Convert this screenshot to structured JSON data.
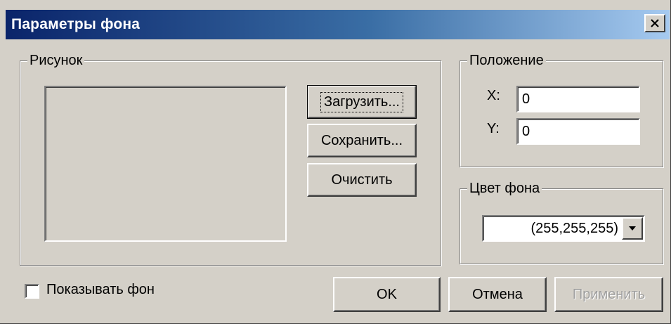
{
  "window": {
    "title": "Параметры фона",
    "close_icon": "close-icon"
  },
  "picture_group": {
    "label": "Рисунок",
    "load_button": "Загрузить...",
    "save_button": "Сохранить...",
    "clear_button": "Очистить"
  },
  "position_group": {
    "label": "Положение",
    "x_label": "X:",
    "x_value": "0",
    "y_label": "Y:",
    "y_value": "0"
  },
  "color_group": {
    "label": "Цвет фона",
    "selected": "(255,255,255)",
    "dropdown_icon": "chevron-down-icon"
  },
  "show_background": {
    "label": "Показывать фон",
    "checked": false
  },
  "footer": {
    "ok": "OK",
    "cancel": "Отмена",
    "apply": "Применить"
  },
  "colors": {
    "titlebar_start": "#0a246a",
    "titlebar_end": "#a6caf0",
    "face": "#d4d0c8"
  }
}
